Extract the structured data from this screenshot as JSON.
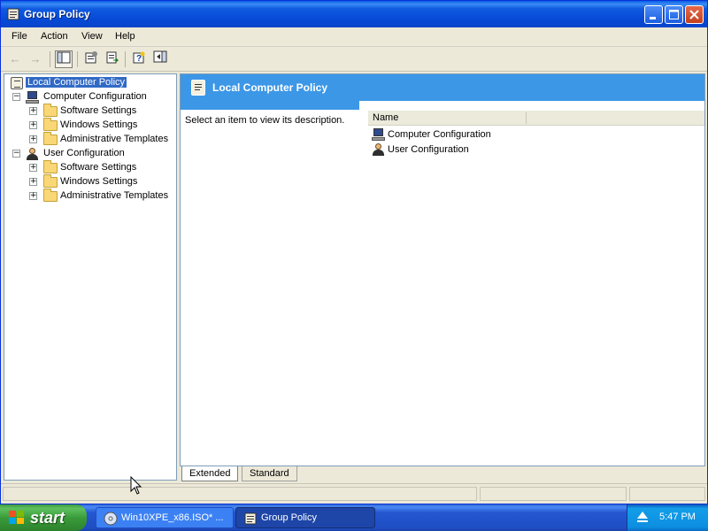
{
  "window": {
    "title": "Group Policy",
    "caption_buttons": [
      "minimize",
      "maximize",
      "close"
    ]
  },
  "menu": [
    "File",
    "Action",
    "View",
    "Help"
  ],
  "toolbar": {
    "buttons": [
      "back-arrow-icon",
      "forward-arrow-icon",
      "show-hide-console-tree-icon",
      "properties-icon",
      "export-list-icon",
      "help-icon",
      "show-hide-action-pane-icon"
    ]
  },
  "tree": {
    "root_label": "Local Computer Policy",
    "computer_config": "Computer Configuration",
    "computer_children": [
      "Software Settings",
      "Windows Settings",
      "Administrative Templates"
    ],
    "user_config": "User Configuration",
    "user_children": [
      "Software Settings",
      "Windows Settings",
      "Administrative Templates"
    ]
  },
  "details": {
    "header_title": "Local Computer Policy",
    "description": "Select an item to view its description.",
    "column_name": "Name",
    "items": [
      "Computer Configuration",
      "User Configuration"
    ]
  },
  "tabs": [
    "Extended",
    "Standard"
  ],
  "taskbar": {
    "start_label": "start",
    "tasks": [
      "Win10XPE_x86.ISO* ...",
      "Group Policy"
    ],
    "clock": "5:47 PM"
  },
  "colors": {
    "title_bar": "#0a54d6",
    "selection": "#316ac5",
    "header_band": "#3c97e7",
    "start_green": "#3a9b3a"
  }
}
